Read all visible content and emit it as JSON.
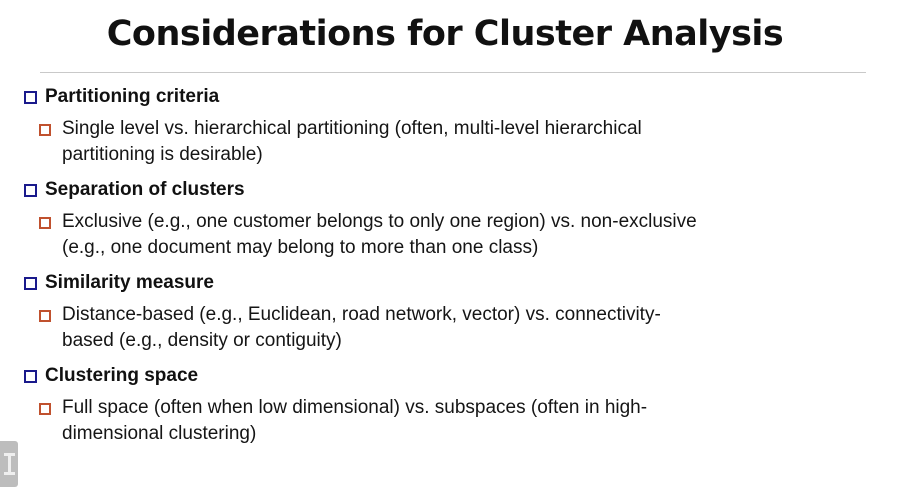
{
  "title": "Considerations for Cluster Analysis",
  "sections": [
    {
      "heading": "Partitioning criteria",
      "detail_line1": "Single level vs. hierarchical partitioning (often, multi-level hierarchical",
      "detail_line2": "partitioning is desirable)"
    },
    {
      "heading": "Separation of clusters",
      "detail_line1": "Exclusive (e.g., one customer belongs to only one region) vs. non-exclusive",
      "detail_line2": "(e.g., one document may belong to more than one class)"
    },
    {
      "heading": "Similarity measure",
      "detail_line1": "Distance-based (e.g., Euclidean, road network, vector)  vs. connectivity-",
      "detail_line2": "based (e.g., density or contiguity)"
    },
    {
      "heading": "Clustering space",
      "detail_line1": "Full space (often when low dimensional) vs. subspaces (often in high-",
      "detail_line2": "dimensional clustering)"
    }
  ],
  "colors": {
    "level1_bullet": "#1a1a8c",
    "level2_bullet": "#c0512e"
  }
}
